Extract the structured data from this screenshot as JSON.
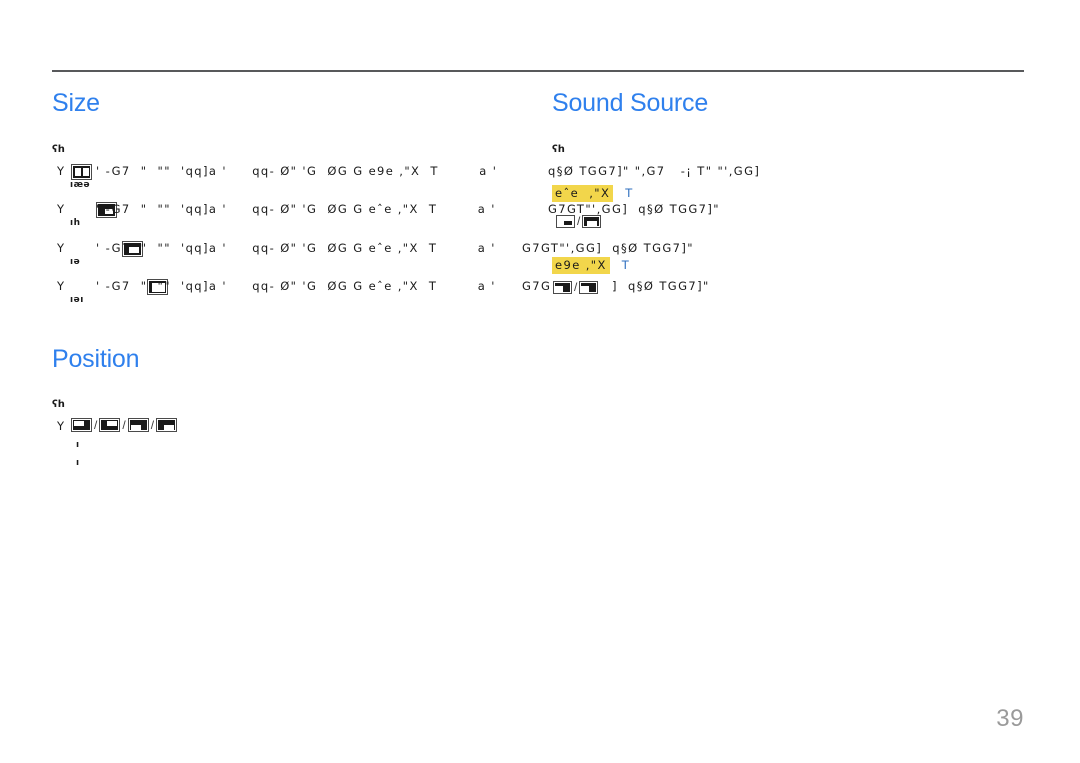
{
  "document": {
    "page_number": "39",
    "accent_color": "#2f80ed",
    "highlight_color": "#f2d64b",
    "rule_color": "#58595b",
    "page_number_color": "#9a9a9a"
  },
  "sections": {
    "size": {
      "heading": "Size",
      "note_marker": "ʕh",
      "rows": [
        {
          "bullet": "Y",
          "icon": "pbp-split-screen-icon",
          "sub_marker": "ıæə",
          "text_before": "' -G7  \"  \"\"  'qq]a '     qq- Ø\" 'G  ØG G e9e ,\"X  T        a '",
          "text_after": "q§Ø TGG7]\" \",G7   -¡ T\" \"',GG]",
          "highlight": null
        },
        {
          "bullet": "Y",
          "icon": "pip-small-bottom-right-icon",
          "sub_marker": "ıh",
          "text_before": "' -G7  \"  \"\"  'qq]a '     qq- Ø\" 'G  ØG G eˆe ,\"X  T        a '",
          "text_after": "G7GT\"',GG]  q§Ø TGG7]\"",
          "highlight": {
            "text": "eˆe  ,\"X",
            "trailing": "T"
          }
        },
        {
          "bullet": "Y",
          "icon": "pip-medium-right-icon",
          "sub_marker": "ıə",
          "text_before": "' -G7  \"  \"\"  'qq]a '     qq- Ø\" 'G  ØG G eˆe ,\"X  T        a '",
          "text_after": "G7GT\"',GG]  q§Ø TGG7]\"",
          "highlight": null
        },
        {
          "bullet": "Y",
          "icon": "pip-large-icon",
          "sub_marker": "ıəı",
          "text_before": "' -G7  \"  \"\"  'qq]a '     qq- Ø\" 'G  ØG G eˆe ,\"X  T        a '",
          "text_after": "G7G",
          "text_tail": "q§Ø TGG7]\"",
          "highlight": {
            "text": "e9e ,\"X",
            "trailing": "T"
          }
        }
      ]
    },
    "sound_source": {
      "heading": "Sound Source",
      "note_marker": "ʕh",
      "rows": [
        {
          "text": "q§Ø TGG7]\" \",G7   -¡ T\" \"',GG]"
        },
        {
          "text": "G7GT\"',GG]  q§Ø TGG7]\""
        },
        {
          "text": "G7GT\"',GG]  q§Ø TGG7]\""
        },
        {
          "text": "G7G",
          "tail": "]  q§Ø TGG7]\""
        }
      ],
      "icon_pairs": [
        {
          "left": "pip-small-bottom-right-outline-icon",
          "separator": "/",
          "right": "pip-small-bottom-left-filled-icon"
        },
        {
          "left": "pip-corner-pair-left-icon",
          "separator": "/",
          "right": "pip-corner-pair-right-icon"
        }
      ]
    },
    "position": {
      "heading": "Position",
      "note_marker": "ʕh",
      "bullet": "Y",
      "sub_markers": [
        "ı",
        "ı"
      ],
      "separator": "/",
      "icons": [
        "pip-position-top-left-icon",
        "pip-position-top-right-icon",
        "pip-position-bottom-left-icon",
        "pip-position-bottom-right-icon"
      ]
    }
  }
}
